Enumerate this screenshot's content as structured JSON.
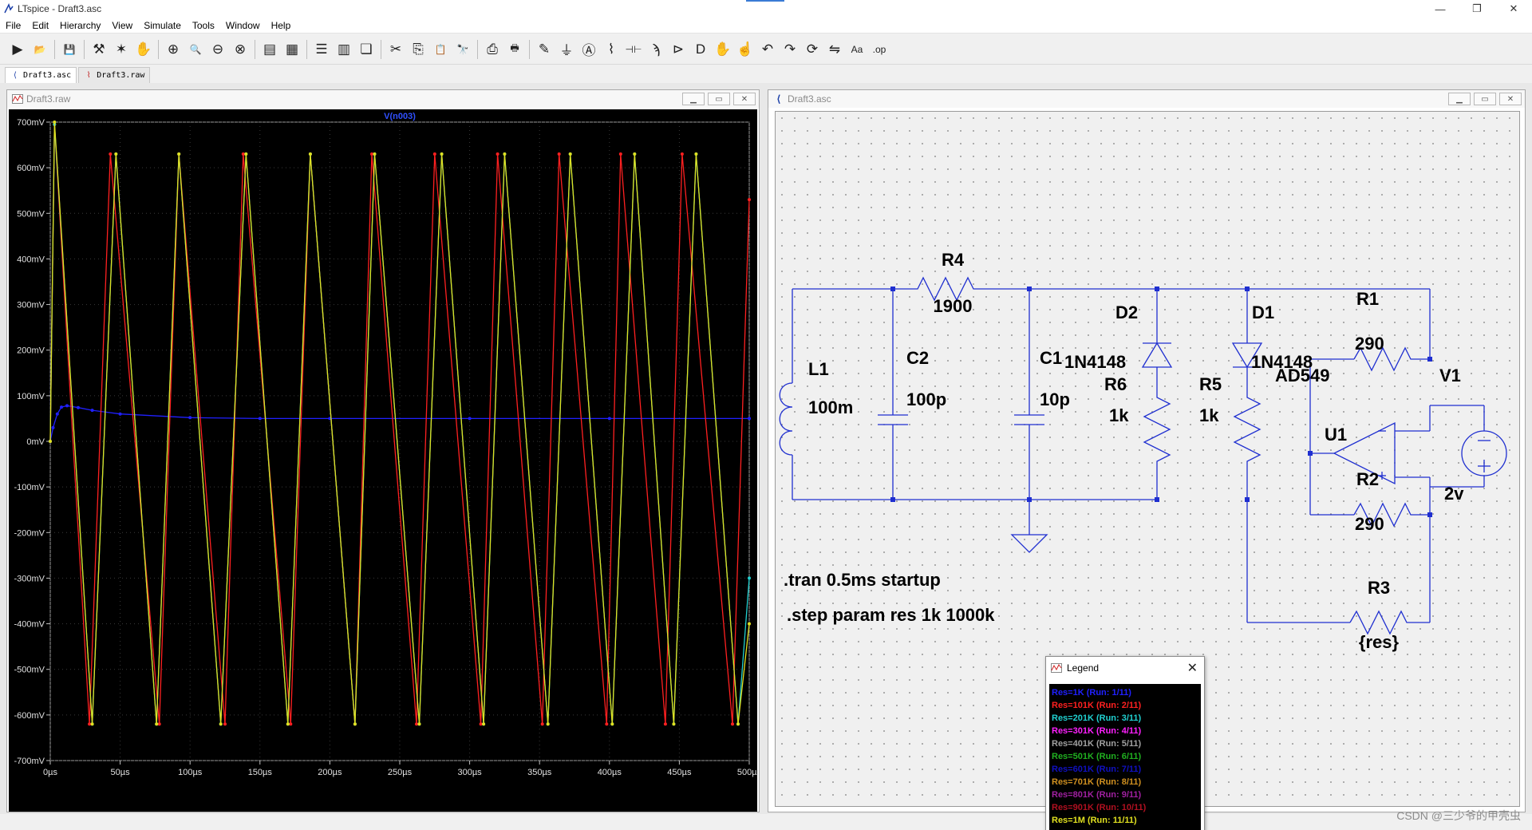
{
  "app": {
    "title": "LTspice - Draft3.asc"
  },
  "window_controls": {
    "minimize": "—",
    "maximize": "❐",
    "close": "✕"
  },
  "menu": [
    "File",
    "Edit",
    "Hierarchy",
    "View",
    "Simulate",
    "Tools",
    "Window",
    "Help"
  ],
  "toolbar": [
    {
      "icon": "run-icon",
      "glyph": "▶"
    },
    {
      "icon": "open-icon",
      "glyph": "📂"
    },
    {
      "icon": "sep"
    },
    {
      "icon": "save-icon",
      "glyph": "💾"
    },
    {
      "icon": "sep"
    },
    {
      "icon": "control-panel-icon",
      "glyph": "⚒"
    },
    {
      "icon": "halt-icon",
      "glyph": "✶"
    },
    {
      "icon": "pan-icon",
      "glyph": "✋"
    },
    {
      "icon": "sep"
    },
    {
      "icon": "zoom-in-icon",
      "glyph": "⊕"
    },
    {
      "icon": "zoom-area-icon",
      "glyph": "🔍"
    },
    {
      "icon": "zoom-out-icon",
      "glyph": "⊖"
    },
    {
      "icon": "zoom-fit-icon",
      "glyph": "⊗"
    },
    {
      "icon": "sep"
    },
    {
      "icon": "autorange-icon",
      "glyph": "▤"
    },
    {
      "icon": "grid-icon",
      "glyph": "▦"
    },
    {
      "icon": "sep"
    },
    {
      "icon": "tile-horizontal-icon",
      "glyph": "☰"
    },
    {
      "icon": "tile-vertical-icon",
      "glyph": "▥"
    },
    {
      "icon": "cascade-icon",
      "glyph": "❏"
    },
    {
      "icon": "sep"
    },
    {
      "icon": "cut-icon",
      "glyph": "✂"
    },
    {
      "icon": "copy-icon",
      "glyph": "⎘"
    },
    {
      "icon": "paste-icon",
      "glyph": "📋"
    },
    {
      "icon": "find-icon",
      "glyph": "🔭"
    },
    {
      "icon": "sep"
    },
    {
      "icon": "print-icon",
      "glyph": "⎙"
    },
    {
      "icon": "print-preview-icon",
      "glyph": "🖶"
    },
    {
      "icon": "sep"
    },
    {
      "icon": "wire-icon",
      "glyph": "✎"
    },
    {
      "icon": "ground-icon",
      "glyph": "⏚"
    },
    {
      "icon": "label-net-icon",
      "glyph": "Ⓐ"
    },
    {
      "icon": "resistor-icon",
      "glyph": "⌇"
    },
    {
      "icon": "capacitor-icon",
      "glyph": "⊣⊢"
    },
    {
      "icon": "inductor-icon",
      "glyph": "ϡ"
    },
    {
      "icon": "diode-icon",
      "glyph": "⊳"
    },
    {
      "icon": "component-icon",
      "glyph": "D"
    },
    {
      "icon": "move-icon",
      "glyph": "✋"
    },
    {
      "icon": "drag-icon",
      "glyph": "☝"
    },
    {
      "icon": "undo-icon",
      "glyph": "↶"
    },
    {
      "icon": "redo-icon",
      "glyph": "↷"
    },
    {
      "icon": "rotate-icon",
      "glyph": "⟳"
    },
    {
      "icon": "mirror-icon",
      "glyph": "⇋"
    },
    {
      "icon": "text-icon",
      "glyph": "Aa"
    },
    {
      "icon": "spice-directive-icon",
      "glyph": ".op"
    }
  ],
  "tabs": [
    {
      "label": "Draft3.asc",
      "active": true
    },
    {
      "label": "Draft3.raw",
      "active": false
    }
  ],
  "plot_window": {
    "title": "Draft3.raw",
    "trace_name": "V(n003)"
  },
  "schematic_window": {
    "title": "Draft3.asc",
    "components": {
      "R4": {
        "name": "R4",
        "value": "1900"
      },
      "C2": {
        "name": "C2",
        "value": "100p"
      },
      "C1": {
        "name": "C1",
        "value": "10p"
      },
      "L1": {
        "name": "L1",
        "value": "100m"
      },
      "D2": {
        "name": "D2",
        "value": "1N4148"
      },
      "D1": {
        "name": "D1",
        "value": "1N4148"
      },
      "R6": {
        "name": "R6",
        "value": "1k"
      },
      "R5": {
        "name": "R5",
        "value": "1k"
      },
      "R1": {
        "name": "R1",
        "value": "290"
      },
      "R2": {
        "name": "R2",
        "value": "290"
      },
      "R3": {
        "name": "R3",
        "value": "{res}"
      },
      "U1": {
        "name": "U1",
        "value": "AD549"
      },
      "V1": {
        "name": "V1",
        "value": "2v"
      }
    },
    "directives": [
      ".tran 0.5ms startup",
      ".step param res 1k 1000k"
    ]
  },
  "legend": {
    "title": "Legend",
    "entries": [
      {
        "label": "Res=1K  (Run: 1/11)",
        "color": "#2020ff"
      },
      {
        "label": "Res=101K  (Run: 2/11)",
        "color": "#ff2020"
      },
      {
        "label": "Res=201K  (Run: 3/11)",
        "color": "#20d0d0"
      },
      {
        "label": "Res=301K  (Run: 4/11)",
        "color": "#ff20ff"
      },
      {
        "label": "Res=401K  (Run: 5/11)",
        "color": "#a0a0a0"
      },
      {
        "label": "Res=501K  (Run: 6/11)",
        "color": "#20b020"
      },
      {
        "label": "Res=601K  (Run: 7/11)",
        "color": "#1010c0"
      },
      {
        "label": "Res=701K  (Run: 8/11)",
        "color": "#d09020"
      },
      {
        "label": "Res=801K  (Run: 9/11)",
        "color": "#a020a0"
      },
      {
        "label": "Res=901K  (Run: 10/11)",
        "color": "#b01020"
      },
      {
        "label": "Res=1M  (Run: 11/11)",
        "color": "#e0e020"
      }
    ]
  },
  "watermark": "CSDN @三少爷的甲壳虫",
  "chart_data": {
    "type": "line",
    "title": "V(n003)",
    "xlabel": "",
    "ylabel": "",
    "x_ticks": [
      "0µs",
      "50µs",
      "100µs",
      "150µs",
      "200µs",
      "250µs",
      "300µs",
      "350µs",
      "400µs",
      "450µs",
      "500µs"
    ],
    "y_ticks": [
      "700mV",
      "600mV",
      "500mV",
      "400mV",
      "300mV",
      "200mV",
      "100mV",
      "0mV",
      "-100mV",
      "-200mV",
      "-300mV",
      "-400mV",
      "-500mV",
      "-600mV",
      "-700mV"
    ],
    "xlim": [
      0,
      500
    ],
    "x_unit": "µs",
    "ylim": [
      -700,
      700
    ],
    "y_unit": "mV",
    "grid": true,
    "series": [
      {
        "run": 1,
        "color": "#2020ff",
        "x": [
          0,
          2,
          5,
          8,
          12,
          20,
          30,
          50,
          100,
          150,
          200,
          300,
          400,
          500
        ],
        "y": [
          0,
          30,
          60,
          75,
          78,
          74,
          68,
          60,
          52,
          50,
          50,
          50,
          50,
          50
        ]
      },
      {
        "run": 2,
        "color": "#ff2020",
        "x": [
          0,
          3,
          28,
          43,
          78,
          92,
          125,
          138,
          172,
          186,
          218,
          230,
          262,
          275,
          308,
          320,
          352,
          364,
          398,
          408,
          440,
          452,
          488,
          500
        ],
        "y": [
          0,
          695,
          -620,
          630,
          -620,
          630,
          -620,
          630,
          -620,
          630,
          -620,
          630,
          -620,
          630,
          -620,
          630,
          -620,
          630,
          -620,
          630,
          -620,
          630,
          -620,
          530
        ]
      },
      {
        "run": 3,
        "color": "#20d0d0",
        "x": [
          0,
          3,
          30,
          47,
          76,
          92,
          122,
          140,
          170,
          186,
          218,
          232,
          264,
          280,
          310,
          325,
          356,
          372,
          402,
          418,
          446,
          462,
          492,
          500
        ],
        "y": [
          0,
          695,
          -620,
          630,
          -620,
          630,
          -620,
          630,
          -620,
          630,
          -620,
          630,
          -620,
          630,
          -620,
          630,
          -620,
          630,
          -620,
          630,
          -620,
          630,
          -620,
          -300
        ]
      },
      {
        "run": 11,
        "color": "#e0e020",
        "x": [
          0,
          3,
          30,
          47,
          76,
          92,
          122,
          140,
          170,
          186,
          218,
          232,
          264,
          280,
          310,
          325,
          356,
          372,
          402,
          418,
          446,
          462,
          492,
          500
        ],
        "y": [
          0,
          700,
          -620,
          630,
          -620,
          630,
          -620,
          630,
          -620,
          630,
          -620,
          630,
          -620,
          630,
          -620,
          630,
          -620,
          630,
          -620,
          630,
          -620,
          630,
          -620,
          -400
        ]
      }
    ]
  }
}
